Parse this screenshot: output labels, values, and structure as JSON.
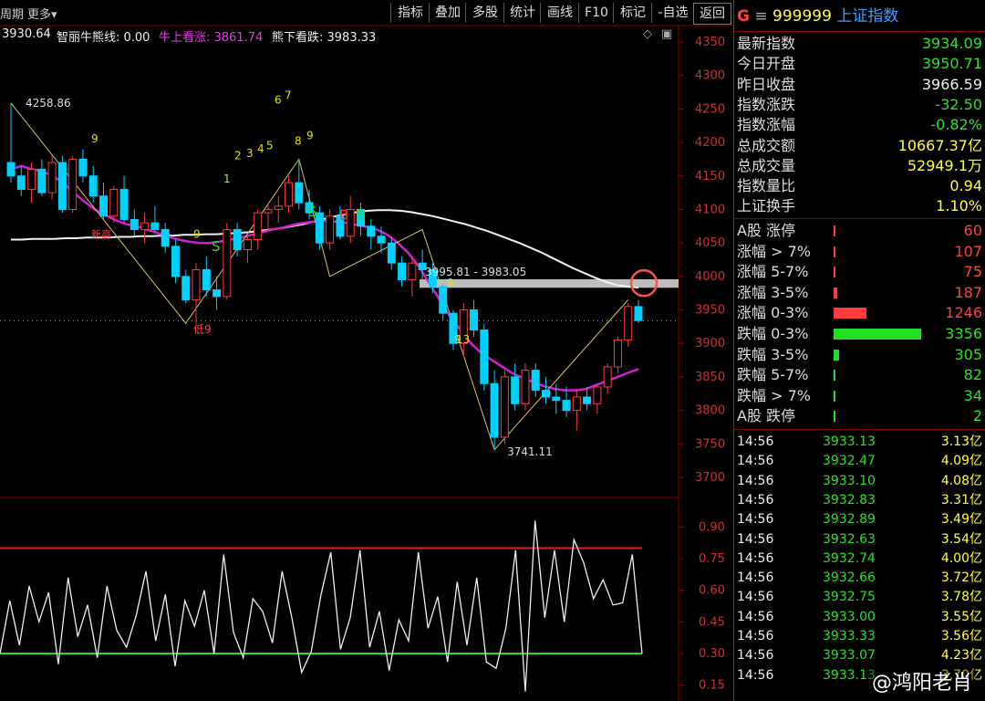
{
  "toolbar": {
    "period_label": "周期",
    "more_label": "更多▾",
    "tabs": [
      "指标",
      "叠加",
      "多股",
      "统计",
      "画线",
      "F10",
      "标记",
      "-自选",
      "返回"
    ]
  },
  "indicator_line": {
    "value_prefix": "3930.64",
    "zhili_label": "智丽牛熊线: 0.00",
    "bull_label": "牛上看涨: 3861.74",
    "bear_label": "熊下看跌: 3983.33"
  },
  "price_axis": [
    "4350",
    "4300",
    "4250",
    "4200",
    "4150",
    "4100",
    "4050",
    "4000",
    "3950",
    "3900",
    "3850",
    "3800",
    "3750",
    "3700"
  ],
  "osc_axis": [
    "0.90",
    "0.75",
    "0.60",
    "0.45",
    "0.30",
    "0.15"
  ],
  "annotations": {
    "high": "4258.86",
    "low": "3741.11",
    "range": "3995.81 - 3983.05",
    "low9": "低9",
    "new_label": "新高",
    "nums": [
      "9",
      "1",
      "2",
      "3",
      "4",
      "5",
      "6",
      "7",
      "8",
      "9",
      "9",
      "9",
      "9",
      "13"
    ],
    "s_marks": [
      "S",
      "S",
      "S"
    ],
    "b_mark": "B"
  },
  "colors": {
    "up": "#ff3b3b",
    "down": "#00d2ff",
    "ma_purple": "#d020d0",
    "ma_white": "#f0f0f0",
    "resist": "#bdbdbd",
    "osc_red": "#e02020",
    "osc_green": "#20e020"
  },
  "panel": {
    "code": "999999",
    "name": "上证指数",
    "g": "G",
    "quote": [
      {
        "k": "最新指数",
        "v": "3934.09",
        "c": "green"
      },
      {
        "k": "今日开盘",
        "v": "3950.71",
        "c": "green"
      },
      {
        "k": "昨日收盘",
        "v": "3966.59",
        "c": "white"
      },
      {
        "k": "指数涨跌",
        "v": "-32.50",
        "c": "green"
      },
      {
        "k": "指数涨幅",
        "v": "-0.82%",
        "c": "green"
      },
      {
        "k": "总成交额",
        "v": "10667.37亿",
        "c": "yellow"
      },
      {
        "k": "总成交量",
        "v": "52949.1万",
        "c": "yellow"
      },
      {
        "k": "指数量比",
        "v": "0.94",
        "c": "yellow"
      },
      {
        "k": "上证换手",
        "v": "1.10%",
        "c": "yellow"
      }
    ],
    "breadth": [
      {
        "k": "A股 涨停",
        "v": "60",
        "c": "red",
        "ratio": 0.0
      },
      {
        "k": "涨幅 > 7%",
        "v": "107",
        "c": "red",
        "ratio": 0.02
      },
      {
        "k": "涨幅 5-7%",
        "v": "75",
        "c": "red",
        "ratio": 0.01
      },
      {
        "k": "涨幅 3-5%",
        "v": "187",
        "c": "red",
        "ratio": 0.04
      },
      {
        "k": "涨幅 0-3%",
        "v": "1246",
        "c": "red",
        "ratio": 0.37
      },
      {
        "k": "跌幅 0-3%",
        "v": "3356",
        "c": "green",
        "ratio": 1.0
      },
      {
        "k": "跌幅 3-5%",
        "v": "305",
        "c": "green",
        "ratio": 0.06
      },
      {
        "k": "跌幅 5-7%",
        "v": "82",
        "c": "green",
        "ratio": 0.01
      },
      {
        "k": "跌幅 > 7%",
        "v": "34",
        "c": "green",
        "ratio": 0.01
      },
      {
        "k": "A股 跌停",
        "v": "2",
        "c": "green",
        "ratio": 0.0
      }
    ],
    "ticks": [
      {
        "t": "14:56",
        "p": "3933.13",
        "a": "3.13亿"
      },
      {
        "t": "14:56",
        "p": "3932.47",
        "a": "4.09亿"
      },
      {
        "t": "14:56",
        "p": "3933.10",
        "a": "4.08亿"
      },
      {
        "t": "14:56",
        "p": "3932.83",
        "a": "3.31亿"
      },
      {
        "t": "14:56",
        "p": "3932.89",
        "a": "3.49亿"
      },
      {
        "t": "14:56",
        "p": "3932.63",
        "a": "3.54亿"
      },
      {
        "t": "14:56",
        "p": "3932.74",
        "a": "4.00亿"
      },
      {
        "t": "14:56",
        "p": "3932.66",
        "a": "3.72亿"
      },
      {
        "t": "14:56",
        "p": "3932.75",
        "a": "3.78亿"
      },
      {
        "t": "14:56",
        "p": "3933.00",
        "a": "3.55亿"
      },
      {
        "t": "14:56",
        "p": "3933.33",
        "a": "3.56亿"
      },
      {
        "t": "14:56",
        "p": "3933.07",
        "a": "4.23亿"
      },
      {
        "t": "14:56",
        "p": "3933.13",
        "a": "3.70亿"
      }
    ]
  },
  "watermark": "@鸿阳老肖",
  "chart_data": {
    "type": "candlestick",
    "y_range": [
      3700,
      4350
    ],
    "candles": [
      [
        4170,
        4258.86,
        4140,
        4150
      ],
      [
        4150,
        4165,
        4120,
        4130
      ],
      [
        4130,
        4170,
        4110,
        4160
      ],
      [
        4160,
        4175,
        4120,
        4125
      ],
      [
        4125,
        4180,
        4115,
        4170
      ],
      [
        4170,
        4180,
        4095,
        4100
      ],
      [
        4100,
        4180,
        4095,
        4175
      ],
      [
        4175,
        4190,
        4140,
        4150
      ],
      [
        4150,
        4165,
        4110,
        4120
      ],
      [
        4120,
        4140,
        4085,
        4090
      ],
      [
        4090,
        4135,
        4080,
        4130
      ],
      [
        4130,
        4150,
        4080,
        4085
      ],
      [
        4085,
        4100,
        4060,
        4070
      ],
      [
        4070,
        4095,
        4050,
        4080
      ],
      [
        4080,
        4105,
        4065,
        4070
      ],
      [
        4070,
        4080,
        4035,
        4045
      ],
      [
        4045,
        4055,
        3990,
        4000
      ],
      [
        4000,
        4010,
        3960,
        3965
      ],
      [
        3965,
        4020,
        3930,
        4010
      ],
      [
        4010,
        4030,
        3970,
        3980
      ],
      [
        3980,
        4000,
        3950,
        3970
      ],
      [
        3970,
        4080,
        3965,
        4070
      ],
      [
        4070,
        4080,
        4030,
        4040
      ],
      [
        4040,
        4060,
        4020,
        4055
      ],
      [
        4055,
        4100,
        4040,
        4095
      ],
      [
        4095,
        4110,
        4070,
        4100
      ],
      [
        4100,
        4120,
        4080,
        4105
      ],
      [
        4105,
        4150,
        4095,
        4140
      ],
      [
        4140,
        4175,
        4100,
        4110
      ],
      [
        4110,
        4130,
        4085,
        4095
      ],
      [
        4095,
        4105,
        4040,
        4050
      ],
      [
        4050,
        4100,
        4040,
        4090
      ],
      [
        4090,
        4105,
        4055,
        4060
      ],
      [
        4060,
        4120,
        4050,
        4100
      ],
      [
        4100,
        4110,
        4060,
        4075
      ],
      [
        4075,
        4085,
        4040,
        4060
      ],
      [
        4060,
        4075,
        4035,
        4050
      ],
      [
        4050,
        4060,
        4010,
        4020
      ],
      [
        4020,
        4030,
        3985,
        3995
      ],
      [
        3995,
        4030,
        3970,
        4020
      ],
      [
        4020,
        4040,
        3995,
        4010
      ],
      [
        4010,
        4020,
        3975,
        3985
      ],
      [
        3985,
        3990,
        3935,
        3945
      ],
      [
        3945,
        3950,
        3890,
        3900
      ],
      [
        3900,
        3960,
        3880,
        3950
      ],
      [
        3950,
        3965,
        3910,
        3920
      ],
      [
        3920,
        3930,
        3830,
        3840
      ],
      [
        3840,
        3860,
        3741.11,
        3760
      ],
      [
        3760,
        3860,
        3750,
        3850
      ],
      [
        3850,
        3870,
        3800,
        3810
      ],
      [
        3810,
        3870,
        3800,
        3860
      ],
      [
        3860,
        3870,
        3820,
        3830
      ],
      [
        3830,
        3850,
        3810,
        3820
      ],
      [
        3820,
        3840,
        3795,
        3815
      ],
      [
        3815,
        3835,
        3790,
        3800
      ],
      [
        3800,
        3830,
        3770,
        3820
      ],
      [
        3820,
        3835,
        3800,
        3810
      ],
      [
        3810,
        3840,
        3795,
        3835
      ],
      [
        3835,
        3870,
        3825,
        3865
      ],
      [
        3865,
        3910,
        3855,
        3905
      ],
      [
        3905,
        3960,
        3895,
        3955
      ],
      [
        3955,
        3965,
        3930,
        3934.09
      ]
    ],
    "ma_purple": [
      4160,
      4165,
      4160,
      4157,
      4150,
      4140,
      4125,
      4112,
      4100,
      4092,
      4084,
      4078,
      4075,
      4070,
      4065,
      4060,
      4055,
      4052,
      4050,
      4050,
      4052,
      4055,
      4058,
      4062,
      4066,
      4070,
      4073,
      4077,
      4080,
      4082,
      4083,
      4082,
      4080,
      4077,
      4074,
      4070,
      4062,
      4050,
      4035,
      4015,
      3990,
      3965,
      3940,
      3920,
      3900,
      3885,
      3875,
      3865,
      3855,
      3848,
      3842,
      3836,
      3832,
      3830,
      3830,
      3832,
      3838,
      3844,
      3850,
      3856,
      3861.74
    ],
    "ma_white": [
      4055,
      4055,
      4056,
      4056,
      4056,
      4057,
      4057,
      4058,
      4058,
      4058,
      4059,
      4059,
      4060,
      4060,
      4061,
      4061,
      4062,
      4062,
      4063,
      4063,
      4064,
      4065,
      4066,
      4068,
      4070,
      4072,
      4075,
      4078,
      4082,
      4086,
      4090,
      4093,
      4096,
      4098,
      4099,
      4099,
      4098,
      4096,
      4093,
      4090,
      4086,
      4082,
      4078,
      4073,
      4068,
      4062,
      4056,
      4050,
      4043,
      4036,
      4028,
      4020,
      4012,
      4005,
      3998,
      3992,
      3987,
      3985,
      3983.33
    ],
    "oscillator": [
      0.3,
      0.55,
      0.34,
      0.62,
      0.45,
      0.59,
      0.25,
      0.66,
      0.38,
      0.53,
      0.28,
      0.62,
      0.41,
      0.33,
      0.48,
      0.69,
      0.36,
      0.58,
      0.24,
      0.55,
      0.43,
      0.6,
      0.3,
      0.77,
      0.4,
      0.28,
      0.56,
      0.5,
      0.35,
      0.69,
      0.47,
      0.21,
      0.31,
      0.58,
      0.78,
      0.32,
      0.47,
      0.79,
      0.33,
      0.5,
      0.22,
      0.46,
      0.36,
      0.78,
      0.42,
      0.57,
      0.26,
      0.64,
      0.34,
      0.66,
      0.26,
      0.23,
      0.42,
      0.79,
      0.12,
      0.93,
      0.47,
      0.79,
      0.45,
      0.84,
      0.73,
      0.56,
      0.65,
      0.53,
      0.54,
      0.77,
      0.3
    ],
    "osc_upper": 0.8,
    "osc_lower": 0.3
  }
}
